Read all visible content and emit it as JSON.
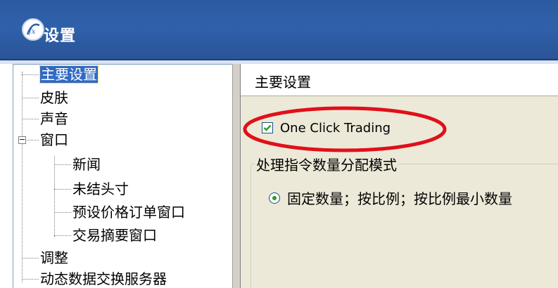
{
  "window": {
    "title": "设置",
    "logo_icon": "fx-logo-icon"
  },
  "tree": {
    "items": [
      {
        "label": "主要设置",
        "selected": true
      },
      {
        "label": "皮肤"
      },
      {
        "label": "声音"
      },
      {
        "label": "窗口",
        "expander": "−"
      },
      {
        "label": "新闻"
      },
      {
        "label": "未结头寸"
      },
      {
        "label": "预设价格订单窗口"
      },
      {
        "label": "交易摘要窗口"
      },
      {
        "label": "调整"
      },
      {
        "label": "动态数据交换服务器"
      }
    ]
  },
  "main": {
    "header": "主要设置",
    "one_click": {
      "label": "One Click Trading",
      "checked": true
    },
    "group": {
      "legend": "处理指令数量分配模式",
      "radio_label": "固定数量；按比例；按比例最小数量",
      "selected": true
    }
  },
  "colors": {
    "title_bar": "#2f61ab",
    "selection": "#316ac5",
    "panel_bg": "#ece9d8",
    "highlight_ellipse": "#e0101a",
    "check_green": "#21a121"
  }
}
